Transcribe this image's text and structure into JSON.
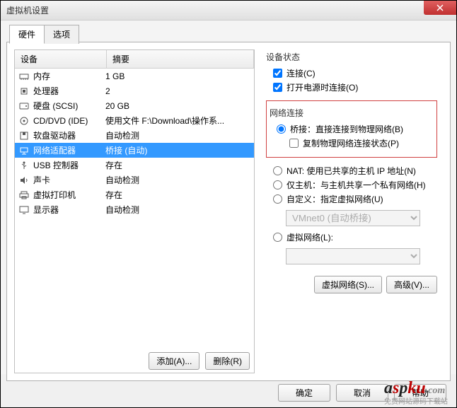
{
  "window": {
    "title": "虚拟机设置"
  },
  "tabs": {
    "hardware": "硬件",
    "options": "选项"
  },
  "list": {
    "header_device": "设备",
    "header_summary": "摘要",
    "items": [
      {
        "name": "内存",
        "summary": "1 GB",
        "icon": "memory"
      },
      {
        "name": "处理器",
        "summary": "2",
        "icon": "cpu"
      },
      {
        "name": "硬盘 (SCSI)",
        "summary": "20 GB",
        "icon": "hdd"
      },
      {
        "name": "CD/DVD (IDE)",
        "summary": "使用文件 F:\\Download\\操作系...",
        "icon": "cd"
      },
      {
        "name": "软盘驱动器",
        "summary": "自动检测",
        "icon": "floppy"
      },
      {
        "name": "网络适配器",
        "summary": "桥接 (自动)",
        "icon": "net",
        "selected": true
      },
      {
        "name": "USB 控制器",
        "summary": "存在",
        "icon": "usb"
      },
      {
        "name": "声卡",
        "summary": "自动检测",
        "icon": "sound"
      },
      {
        "name": "虚拟打印机",
        "summary": "存在",
        "icon": "printer"
      },
      {
        "name": "显示器",
        "summary": "自动检测",
        "icon": "display"
      }
    ]
  },
  "left_buttons": {
    "add": "添加(A)...",
    "remove": "删除(R)"
  },
  "right": {
    "device_status_label": "设备状态",
    "connected": "连接(C)",
    "connect_at_power": "打开电源时连接(O)",
    "network_label": "网络连接",
    "bridged": "桥接：直接连接到物理网络(B)",
    "replicate": "复制物理网络连接状态(P)",
    "nat": "NAT: 使用已共享的主机 IP 地址(N)",
    "hostonly": "仅主机：与主机共享一个私有网络(H)",
    "custom": "自定义：指定虚拟网络(U)",
    "custom_value": "VMnet0 (自动桥接)",
    "lan_segment": "虚拟网络(L):",
    "virtual_net_btn": "虚拟网络(S)...",
    "advanced_btn": "高级(V)..."
  },
  "footer": {
    "ok": "确定",
    "cancel": "取消",
    "help": "帮助"
  },
  "watermark": {
    "text": "aspku",
    "tagline": "免费网站源码下载站"
  }
}
